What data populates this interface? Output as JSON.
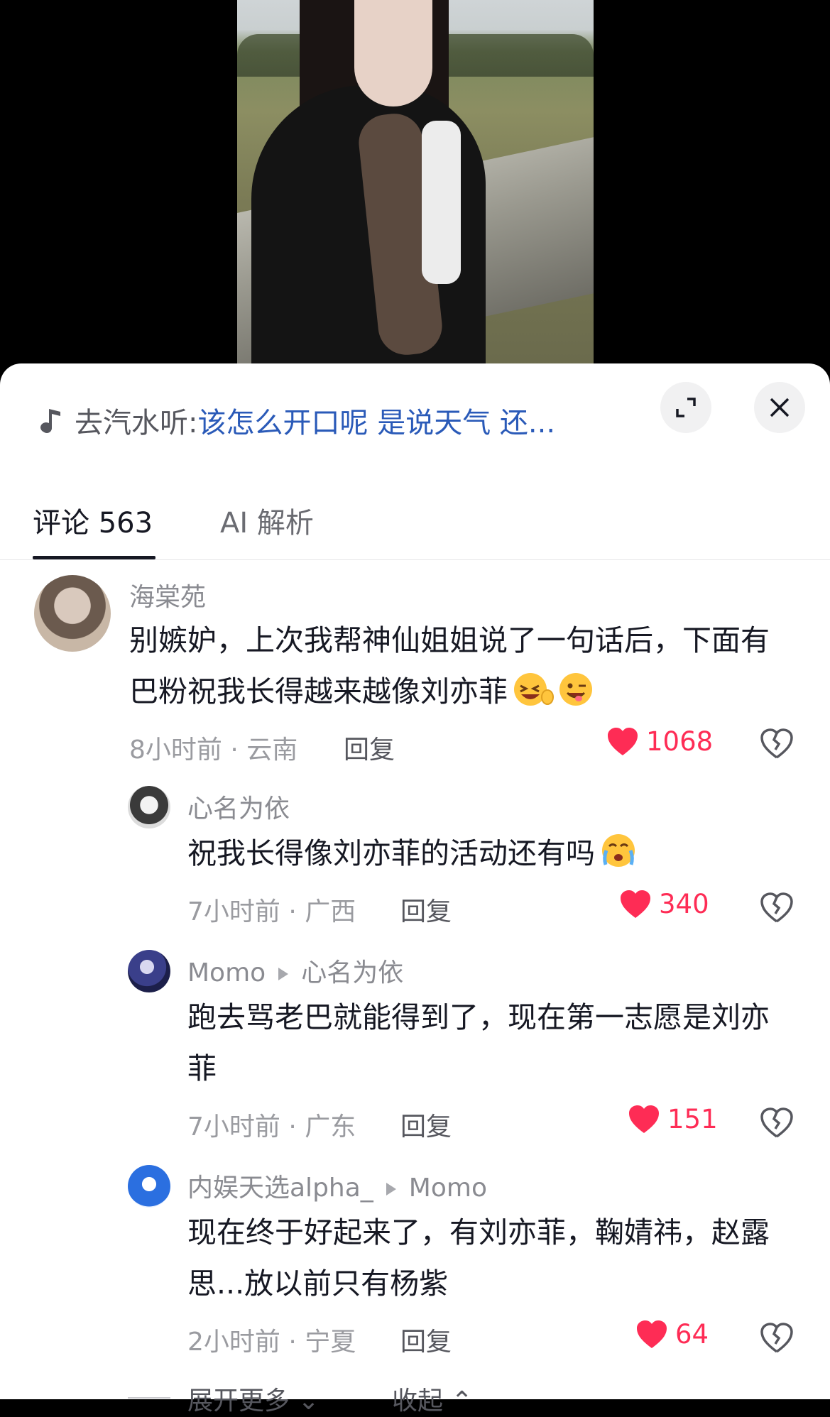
{
  "music": {
    "prefix": "去汽水听:",
    "title": "该怎么开口呢 是说天气 还..."
  },
  "tabs": {
    "comments": "评论 563",
    "ai": "AI 解析"
  },
  "comments": [
    {
      "user": "海棠苑",
      "reply_to": "",
      "text": "别嫉妒，上次我帮神仙姐姐说了一句话后，下面有巴粉祝我长得越来越像刘亦菲",
      "meta": "8小时前 · 云南",
      "reply": "回复",
      "likes": "1068"
    },
    {
      "user": "心名为依",
      "reply_to": "",
      "text": "祝我长得像刘亦菲的活动还有吗",
      "meta": "7小时前 · 广西",
      "reply": "回复",
      "likes": "340"
    },
    {
      "user": "Momo",
      "reply_to": "心名为依",
      "text": "跑去骂老巴就能得到了，现在第一志愿是刘亦菲",
      "meta": "7小时前 · 广东",
      "reply": "回复",
      "likes": "151"
    },
    {
      "user": "内娱天选alpha_",
      "reply_to": "Momo",
      "text": "现在终于好起来了，有刘亦菲，鞠婧祎，赵露思...放以前只有杨紫",
      "meta": "2小时前 · 宁夏",
      "reply": "回复",
      "likes": "64"
    }
  ],
  "footer": {
    "expand": "展开更多",
    "collapse": "收起"
  },
  "colors": {
    "accent_like": "#fe2c55",
    "link": "#2a5ab8"
  }
}
